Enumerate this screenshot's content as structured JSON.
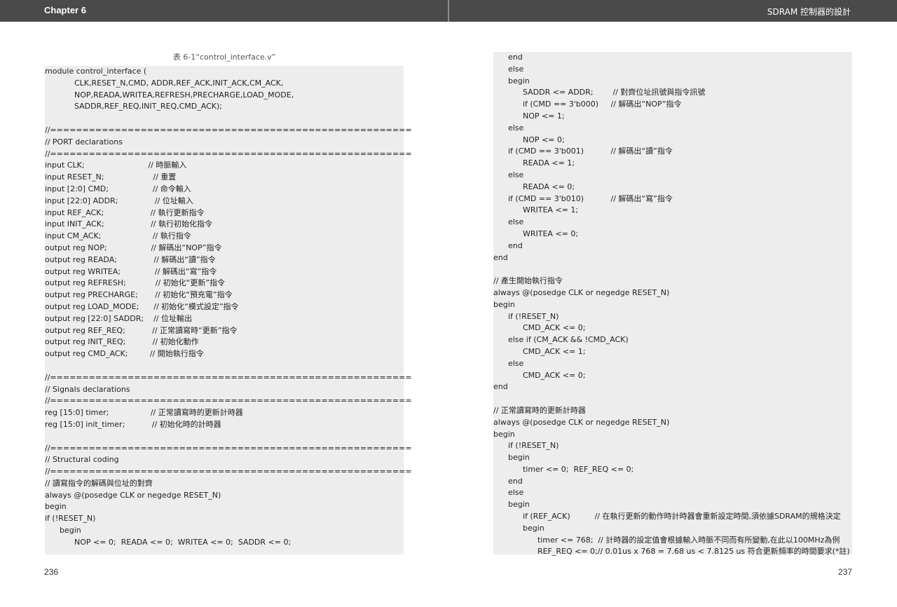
{
  "header": {
    "chapter": "Chapter 6",
    "topic": "SDRAM 控制器的設計"
  },
  "caption": "表 6-1“control_interface.v”",
  "left_code": [
    "module control_interface (",
    "            CLK,RESET_N,CMD, ADDR,REF_ACK,INIT_ACK,CM_ACK,",
    "            NOP,READA,WRITEA,REFRESH,PRECHARGE,LOAD_MODE,",
    "            SADDR,REF_REQ,INIT_REQ,CMD_ACK);",
    "",
    "//========================================================",
    "// PORT declarations",
    "//========================================================",
    "input CLK;                          // 時脈輸入",
    "input RESET_N;                    // 重置",
    "input [2:0] CMD;                  // 命令輸入",
    "input [22:0] ADDR;               // 位址輸入",
    "input REF_ACK;                   // 執行更新指令",
    "input INIT_ACK;                   // 執行初始化指令",
    "input CM_ACK;                     // 執行指令",
    "output reg NOP;                  // 解碼出“NOP”指令",
    "output reg READA;               // 解碼出“讀”指令",
    "output reg WRITEA;              // 解碼出“寫”指令",
    "output reg REFRESH;            // 初始化“更新”指令",
    "output reg PRECHARGE;       // 初始化“預充電”指令",
    "output reg LOAD_MODE;      // 初始化“模式設定”指令",
    "output reg [22:0] SADDR;    // 位址輸出",
    "output reg REF_REQ;           // 正常讀寫時“更新”指令",
    "output reg INIT_REQ;           // 初始化動作",
    "output reg CMD_ACK;         // 開始執行指令",
    "",
    "//========================================================",
    "// Signals declarations",
    "//========================================================",
    "reg [15:0] timer;                 // 正常讀寫時的更新計時器",
    "reg [15:0] init_timer;           // 初始化時的計時器",
    "",
    "//========================================================",
    "// Structural coding",
    "//========================================================",
    "// 讀寫指令的解碼與位址的對齊",
    "always @(posedge CLK or negedge RESET_N)",
    "begin",
    "if (!RESET_N)",
    "      begin",
    "            NOP <= 0;  READA <= 0;  WRITEA <= 0;  SADDR <= 0;"
  ],
  "right_code": [
    "      end",
    "      else",
    "      begin",
    "            SADDR <= ADDR;        // 對齊位址訊號與指令訊號",
    "            if (CMD == 3'b000)     // 解碼出“NOP”指令",
    "            NOP <= 1;",
    "      else",
    "            NOP <= 0;",
    "      if (CMD == 3'b001)           // 解碼出“讀”指令",
    "            READA <= 1;",
    "      else",
    "            READA <= 0;",
    "      if (CMD == 3'b010)           // 解碼出“寫”指令",
    "            WRITEA <= 1;",
    "      else",
    "            WRITEA <= 0;",
    "      end",
    "end",
    "",
    "// 產生開始執行指令",
    "always @(posedge CLK or negedge RESET_N)",
    "begin",
    "      if (!RESET_N)",
    "            CMD_ACK <= 0;",
    "      else if (CM_ACK && !CMD_ACK)",
    "            CMD_ACK <= 1;",
    "      else",
    "            CMD_ACK <= 0;",
    "end",
    "",
    "// 正常讀寫時的更新計時器",
    "always @(posedge CLK or negedge RESET_N)",
    "begin",
    "      if (!RESET_N)",
    "      begin",
    "            timer <= 0;  REF_REQ <= 0;",
    "      end",
    "      else",
    "      begin",
    "            if (REF_ACK)          // 在執行更新的動作時計時器會重新設定時間,須依據SDRAM的規格決定",
    "            begin",
    "                  timer <= 768;  // 計時器的設定值會根據輸入時脈不同而有所變動,在此以100MHz為例",
    "                  REF_REQ <= 0;// 0.01us x 768 = 7.68 us < 7.8125 us 符合更新頻率的時間要求(*註)"
  ],
  "page_left": "236",
  "page_right": "237"
}
